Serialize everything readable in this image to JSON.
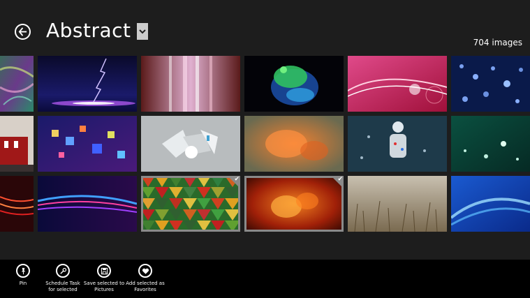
{
  "header": {
    "title": "Abstract",
    "image_count": "704 images"
  },
  "tiles": [
    {
      "name": "tile-swirl",
      "selected": false
    },
    {
      "name": "tile-lightning",
      "selected": false
    },
    {
      "name": "tile-light-streaks",
      "selected": false
    },
    {
      "name": "tile-green-splash",
      "selected": false
    },
    {
      "name": "tile-pink-waves",
      "selected": false
    },
    {
      "name": "tile-water-drops",
      "selected": false
    },
    {
      "name": "tile-red-house",
      "selected": false
    },
    {
      "name": "tile-blue-cubes",
      "selected": false
    },
    {
      "name": "tile-grey-shards",
      "selected": false
    },
    {
      "name": "tile-orange-blur",
      "selected": false
    },
    {
      "name": "tile-dotted-figure",
      "selected": false
    },
    {
      "name": "tile-green-drops",
      "selected": false
    },
    {
      "name": "tile-red-streaks",
      "selected": false
    },
    {
      "name": "tile-purple-waves",
      "selected": false
    },
    {
      "name": "tile-triangle-mosaic",
      "selected": true
    },
    {
      "name": "tile-fire-blur",
      "selected": true
    },
    {
      "name": "tile-grass-field",
      "selected": false
    },
    {
      "name": "tile-blue-swoosh",
      "selected": false
    }
  ],
  "app_bar": {
    "pin": "Pin",
    "schedule": "Schedule Task\nfor selected",
    "save": "Save selected to\nPictures",
    "favorite": "Add selected as\nFavorites"
  },
  "colors": {
    "background": "#1d1d1d",
    "app_bar": "#000000",
    "selection": "#8a8a8a"
  }
}
